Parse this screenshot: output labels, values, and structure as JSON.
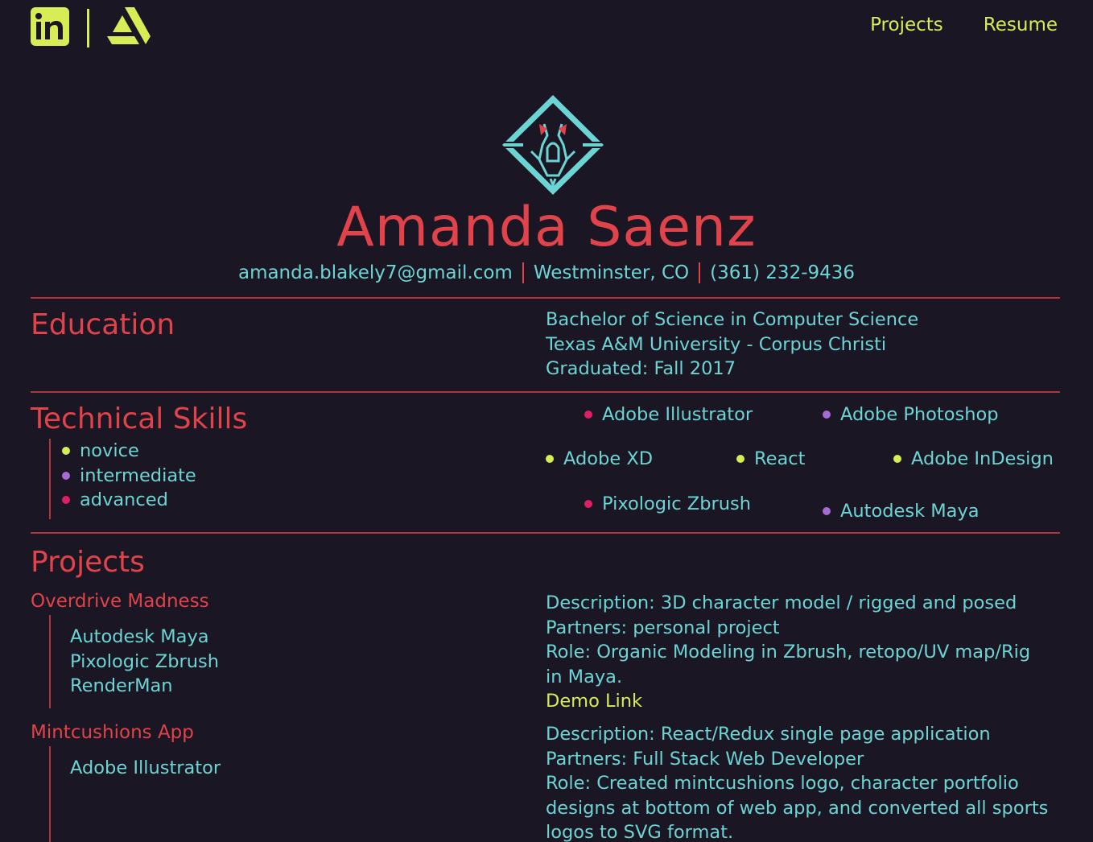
{
  "header": {
    "linkedin_icon": "linkedin-icon",
    "artstation_icon": "artstation-icon",
    "nav": [
      {
        "label": "Projects"
      },
      {
        "label": "Resume"
      }
    ]
  },
  "hero": {
    "logo_icon": "skull-diamond-logo",
    "name": "Amanda Saenz",
    "email": "amanda.blakely7@gmail.com",
    "location": "Westminster, CO",
    "phone": "(361) 232-9436"
  },
  "education": {
    "title": "Education",
    "degree": "Bachelor of Science in Computer Science",
    "school": "Texas A&M University - Corpus Christi",
    "graduated": "Graduated: Fall 2017"
  },
  "skills": {
    "title": "Technical Skills",
    "legend": [
      {
        "label": "novice",
        "color": "#d8ec56"
      },
      {
        "label": "intermediate",
        "color": "#a66bd4"
      },
      {
        "label": "advanced",
        "color": "#dd1f66"
      }
    ],
    "items": [
      {
        "label": "Adobe Illustrator",
        "level": "advanced"
      },
      {
        "label": "Adobe Photoshop",
        "level": "intermediate"
      },
      {
        "label": "Adobe XD",
        "level": "novice"
      },
      {
        "label": "React",
        "level": "novice"
      },
      {
        "label": "Adobe InDesign",
        "level": "novice"
      },
      {
        "label": "Pixologic Zbrush",
        "level": "advanced"
      },
      {
        "label": "Autodesk Maya",
        "level": "intermediate"
      }
    ]
  },
  "projects": {
    "title": "Projects",
    "list": [
      {
        "name": "Overdrive Madness",
        "tools": [
          "Autodesk Maya",
          "Pixologic Zbrush",
          "RenderMan"
        ],
        "description": "Description: 3D character model / rigged and posed",
        "partners": "Partners: personal project",
        "role_line1": "Role: Organic Modeling in Zbrush, retopo/UV map/Rig",
        "role_line2": "in Maya.",
        "link": "Demo Link"
      },
      {
        "name": "Mintcushions App",
        "tools": [
          "Adobe Illustrator"
        ],
        "description": "Description: React/Redux single page application",
        "partners": "Partners: Full Stack Web Developer",
        "role_line1": "Role: Created mintcushions logo, character portfolio",
        "role_line2": "designs at bottom of web app, and converted all sports",
        "role_line3": "logos to SVG format."
      }
    ]
  },
  "colors": {
    "background": "#1b1624",
    "accent_red": "#e0434a",
    "text_cyan": "#6dd4d4",
    "accent_yellow": "#d8ec56"
  }
}
